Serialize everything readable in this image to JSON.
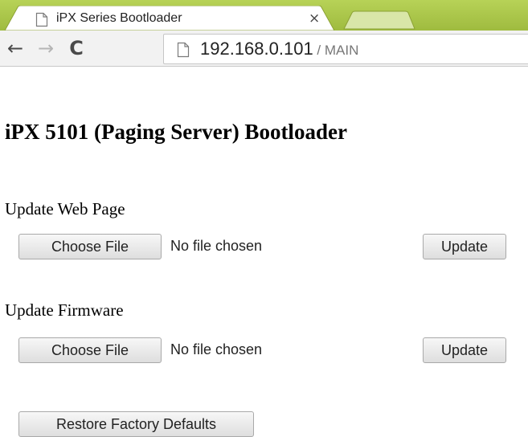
{
  "browser": {
    "tab_title": "iPX Series Bootloader",
    "tab_close": "×",
    "address": {
      "host": "192.168.0.101",
      "path": " / MAIN"
    },
    "nav": {
      "back": "←",
      "forward": "→",
      "reload": "C"
    },
    "colors": {
      "tabstrip": "#a8c34a",
      "toolbar": "#f2f2f2"
    }
  },
  "page": {
    "heading": "iPX 5101 (Paging Server) Bootloader",
    "sections": [
      {
        "label": "Update Web Page",
        "choose_label": "Choose File",
        "file_status": "No file chosen",
        "update_label": "Update"
      },
      {
        "label": "Update Firmware",
        "choose_label": "Choose File",
        "file_status": "No file chosen",
        "update_label": "Update"
      }
    ],
    "restore_label": "Restore Factory Defaults"
  },
  "icons": {
    "tab_favicon": "page-icon",
    "address_icon": "page-icon"
  }
}
